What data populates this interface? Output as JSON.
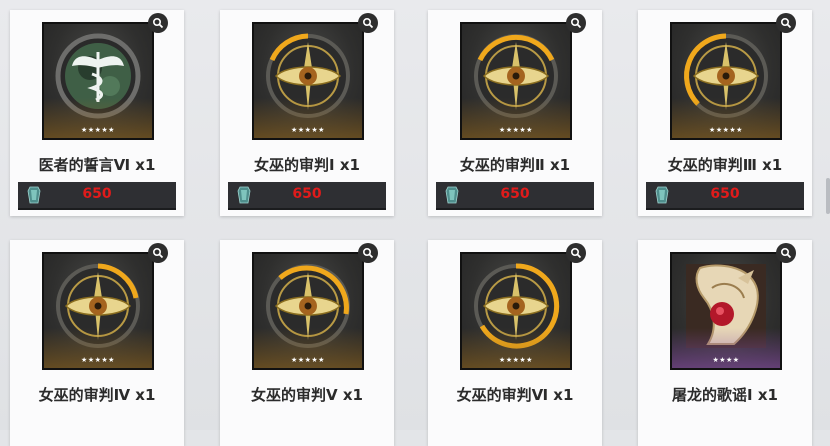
{
  "cards": [
    {
      "name": "医者的誓言Ⅵ x1",
      "price": "650",
      "stars": "★★★★★",
      "art": "caduceus-emblem",
      "rarity": "gold"
    },
    {
      "name": "女巫的审判Ⅰ x1",
      "price": "650",
      "stars": "★★★★★",
      "art": "eye-emblem",
      "rarity": "gold"
    },
    {
      "name": "女巫的审判Ⅱ x1",
      "price": "650",
      "stars": "★★★★★",
      "art": "eye-emblem",
      "rarity": "gold"
    },
    {
      "name": "女巫的审判Ⅲ x1",
      "price": "650",
      "stars": "★★★★★",
      "art": "eye-emblem",
      "rarity": "gold"
    },
    {
      "name": "女巫的审判Ⅳ x1",
      "stars": "★★★★★",
      "art": "eye-emblem",
      "rarity": "gold"
    },
    {
      "name": "女巫的审判Ⅴ x1",
      "stars": "★★★★★",
      "art": "eye-emblem",
      "rarity": "gold"
    },
    {
      "name": "女巫的审判Ⅵ x1",
      "stars": "★★★★★",
      "art": "eye-emblem",
      "rarity": "gold"
    },
    {
      "name": "屠龙的歌谣Ⅰ x1",
      "stars": "★★★★",
      "art": "dragon-emblem",
      "rarity": "purple"
    }
  ],
  "colors": {
    "price": "#e01b1b",
    "bar": "#2e2f33",
    "background": "#e3e5e8"
  },
  "icons": {
    "zoom": "magnifier-icon",
    "currency": "gem-icon"
  }
}
